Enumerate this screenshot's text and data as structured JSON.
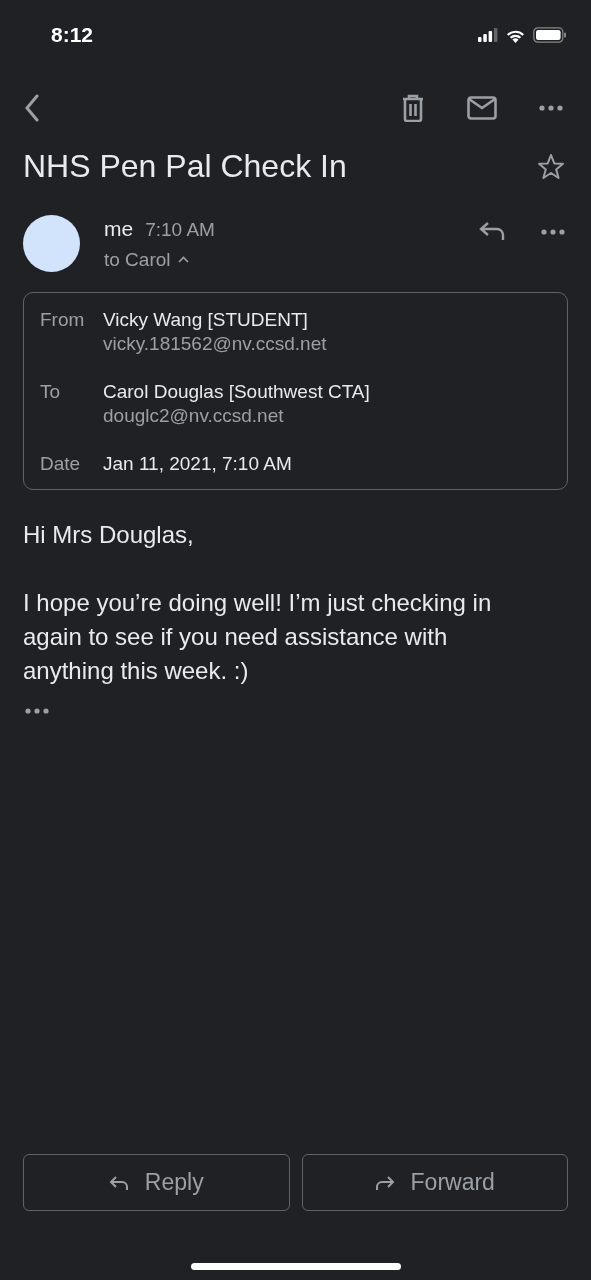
{
  "status_bar": {
    "time": "8:12"
  },
  "message": {
    "subject": "NHS Pen Pal Check In",
    "starred": false,
    "sender": "me",
    "time": "7:10 AM",
    "recipients": "to Carol",
    "details_expanded": true,
    "details": [
      {
        "label": "From",
        "value": "Vicky Wang [STUDENT]",
        "address": "vicky.181562@nv.ccsd.net"
      },
      {
        "label": "To",
        "value": "Carol Douglas [Southwest CTA]",
        "address": "douglc2@nv.ccsd.net"
      },
      {
        "label": "Date",
        "value": "Jan 11, 2021, 7:10 AM"
      }
    ],
    "body": [
      "Hi Mrs Douglas,",
      "I hope you’re doing well! I’m just checking in again to see if you need assistance with anything this week. :)"
    ]
  },
  "buttons": [
    {
      "kind": "reply",
      "label": "Reply"
    },
    {
      "kind": "forward",
      "label": "Forward"
    }
  ]
}
